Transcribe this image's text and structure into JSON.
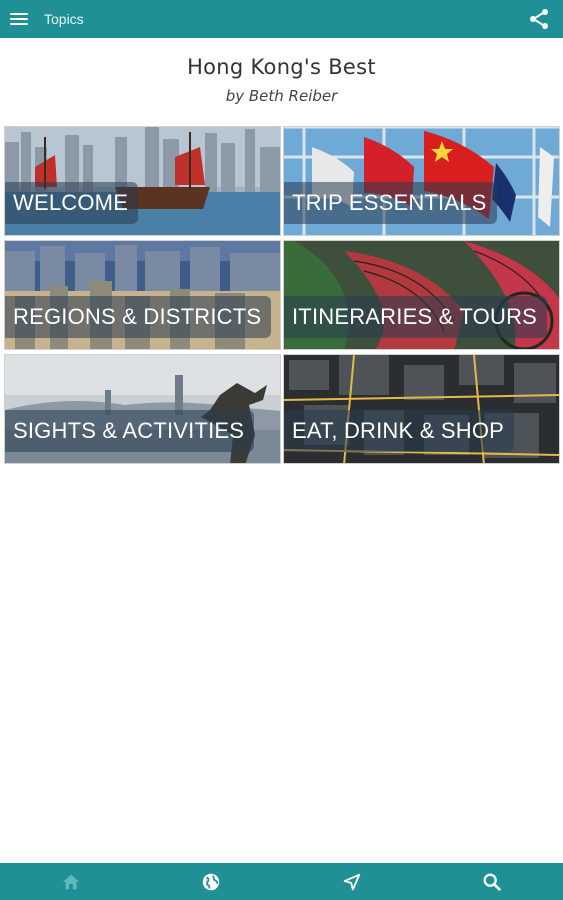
{
  "appbar": {
    "title": "Topics",
    "menu_icon": "menu-icon",
    "share_icon": "share-icon"
  },
  "heading": {
    "title": "Hong Kong's Best",
    "byline": "by Beth Reiber"
  },
  "tiles": [
    {
      "label": "WELCOME"
    },
    {
      "label": "TRIP ESSENTIALS"
    },
    {
      "label": "REGIONS & DISTRICTS"
    },
    {
      "label": "ITINERARIES & TOURS"
    },
    {
      "label": "SIGHTS & ACTIVITIES"
    },
    {
      "label": "EAT, DRINK & SHOP"
    }
  ],
  "bottom_nav": {
    "items": [
      "home-icon",
      "globe-icon",
      "navigation-icon",
      "search-icon"
    ]
  },
  "colors": {
    "bar": "#1f9196",
    "label_overlay": "rgba(40,60,80,0.55)"
  }
}
